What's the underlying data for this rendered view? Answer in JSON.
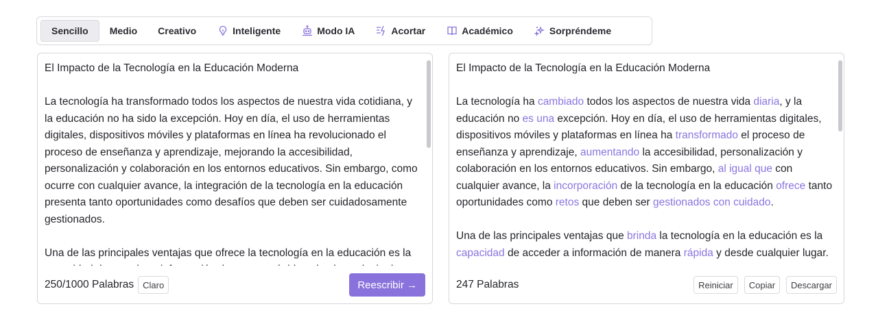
{
  "modes": [
    {
      "label": "Sencillo",
      "icon": null,
      "active": true
    },
    {
      "label": "Medio",
      "icon": null
    },
    {
      "label": "Creativo",
      "icon": null
    },
    {
      "label": "Inteligente",
      "icon": "lightbulb-icon"
    },
    {
      "label": "Modo IA",
      "icon": "robot-icon"
    },
    {
      "label": "Acortar",
      "icon": "shorten-icon"
    },
    {
      "label": "Académico",
      "icon": "book-icon"
    },
    {
      "label": "Sorpréndeme",
      "icon": "sparkle-icon"
    }
  ],
  "colors": {
    "accent": "#8a72dc",
    "highlight": "#8b75e0"
  },
  "input": {
    "title": "El Impacto de la Tecnología en la Educación Moderna",
    "paragraph1": "La tecnología ha transformado todos los aspectos de nuestra vida cotidiana, y la educación no ha sido la excepción. Hoy en día, el uso de herramientas digitales, dispositivos móviles y plataformas en línea ha revolucionado el proceso de enseñanza y aprendizaje, mejorando la accesibilidad, personalización y colaboración en los entornos educativos. Sin embargo, como ocurre con cualquier avance, la integración de la tecnología en la educación presenta tanto oportunidades como desafíos que deben ser cuidadosamente gestionados.",
    "paragraph2": "Una de las principales ventajas que ofrece la tecnología en la educación es la capacidad de acceder a información de manera rápida y desde cualquier lugar.",
    "word_count": "250/1000 Palabras",
    "tone_label": "Claro",
    "rewrite_label": "Reescribir →"
  },
  "output": {
    "title": "El Impacto de la Tecnología en la Educación Moderna",
    "p1": [
      {
        "t": "La tecnología ha "
      },
      {
        "t": "cambiado",
        "hl": true
      },
      {
        "t": " todos los aspectos de nuestra vida "
      },
      {
        "t": "diaria",
        "hl": true
      },
      {
        "t": ", y la educación no "
      },
      {
        "t": "es una",
        "hl": true
      },
      {
        "t": " excepción. Hoy en día, el uso de herramientas digitales, dispositivos móviles y plataformas en línea ha "
      },
      {
        "t": "transformado",
        "hl": true
      },
      {
        "t": " el proceso de enseñanza y aprendizaje, "
      },
      {
        "t": "aumentando",
        "hl": true
      },
      {
        "t": " la accesibilidad, personalización y colaboración en los entornos educativos. Sin embargo, "
      },
      {
        "t": "al igual que",
        "hl": true
      },
      {
        "t": " con cualquier avance, la "
      },
      {
        "t": "incorporación",
        "hl": true
      },
      {
        "t": " de la tecnología en la educación "
      },
      {
        "t": "ofrece",
        "hl": true
      },
      {
        "t": " tanto oportunidades como "
      },
      {
        "t": "retos",
        "hl": true
      },
      {
        "t": " que deben ser "
      },
      {
        "t": "gestionados con cuidado",
        "hl": true
      },
      {
        "t": "."
      }
    ],
    "p2": [
      {
        "t": "Una de las principales ventajas que "
      },
      {
        "t": "brinda",
        "hl": true
      },
      {
        "t": " la tecnología en la educación es la "
      },
      {
        "t": "capacidad",
        "hl": true
      },
      {
        "t": " de acceder a información de manera "
      },
      {
        "t": "rápida",
        "hl": true
      },
      {
        "t": " y desde cualquier lugar."
      }
    ],
    "word_count": "247 Palabras",
    "reset_label": "Reiniciar",
    "copy_label": "Copiar",
    "download_label": "Descargar"
  }
}
